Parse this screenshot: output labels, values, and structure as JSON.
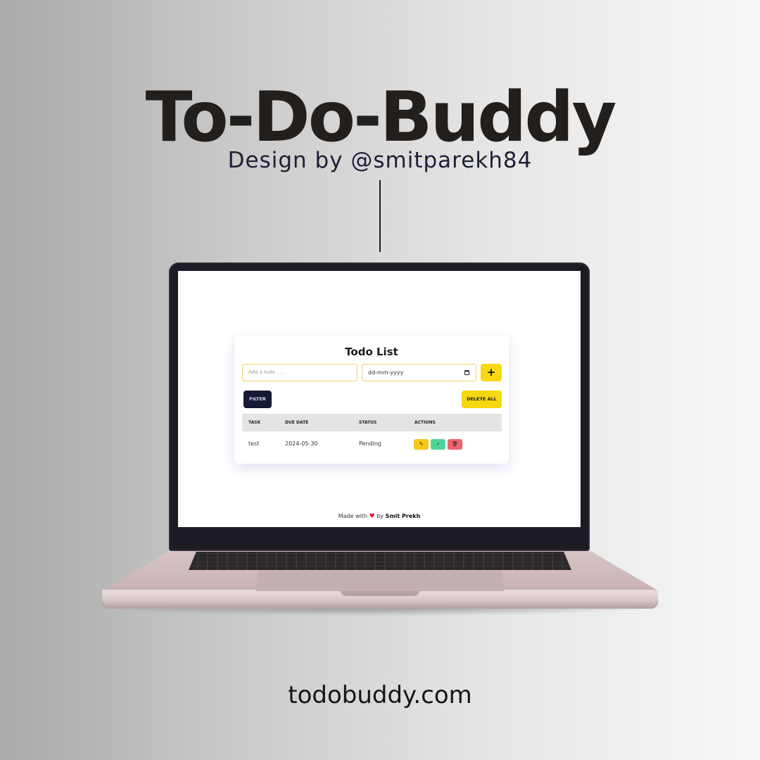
{
  "promo": {
    "title": "To-Do-Buddy",
    "subtitle": "Design by @smitparekh84",
    "url": "todobuddy.com"
  },
  "app": {
    "title": "Todo List",
    "todo_input": {
      "placeholder": "Add a todo . . ."
    },
    "date_input": {
      "placeholder": "dd-mm-yyyy",
      "icon": "calendar-icon"
    },
    "add_button": {
      "label": "+"
    },
    "filter_button": {
      "label": "FILTER"
    },
    "delete_all_button": {
      "label": "DELETE ALL"
    },
    "table": {
      "headers": [
        "TASK",
        "DUE DATE",
        "STATUS",
        "ACTIONS"
      ],
      "rows": [
        {
          "task": "test",
          "due_date": "2024-05-30",
          "status": "Pending",
          "actions": [
            "edit-icon",
            "check-icon",
            "trash-icon"
          ]
        }
      ]
    },
    "footer": {
      "prefix": "Made with",
      "heart": "heart-icon",
      "by": "by",
      "author": "Smit Prekh"
    }
  },
  "colors": {
    "accent_yellow": "#f5d810",
    "filter_dark": "#171a34",
    "action_edit": "#f5c618",
    "action_done": "#4fd49a",
    "action_delete": "#f0626e"
  }
}
